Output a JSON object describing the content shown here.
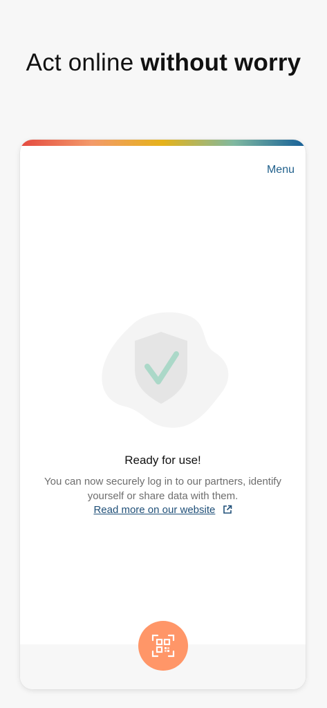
{
  "headline": {
    "normal": "Act online ",
    "bold": "without worry"
  },
  "card": {
    "menu_label": "Menu",
    "status_title": "Ready for use!",
    "description": "You can now securely log in to our partners, identify yourself or share data with them.",
    "read_more_label": "Read more on our website"
  },
  "icons": {
    "shield": "shield-check-icon",
    "external_link": "external-link-icon",
    "qr_scan": "qr-scan-icon"
  },
  "colors": {
    "accent_orange": "#ff9668",
    "link_blue": "#1f5f8b",
    "check_green": "#a9d6c8"
  }
}
